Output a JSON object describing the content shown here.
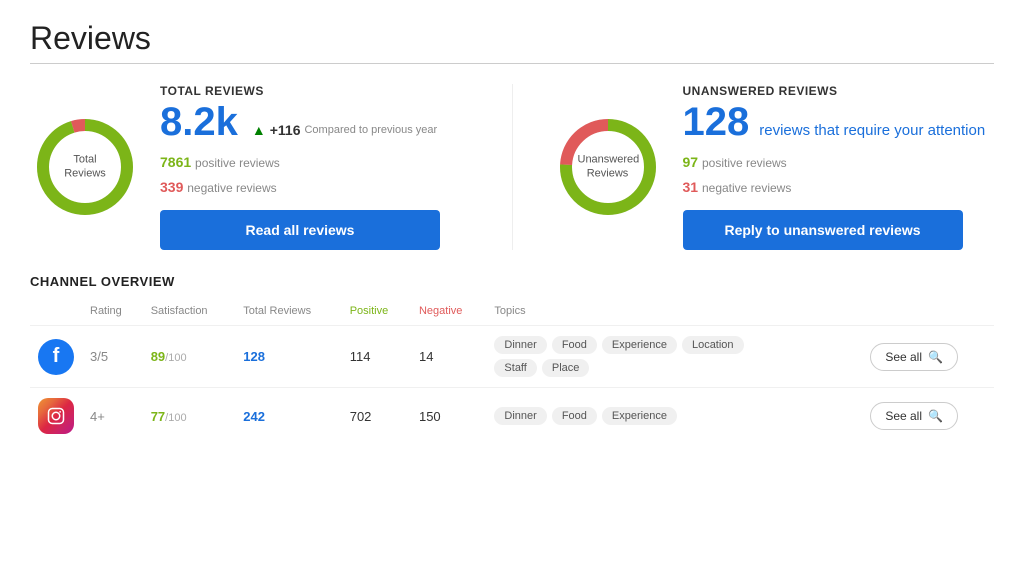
{
  "page": {
    "title": "Reviews"
  },
  "total_reviews": {
    "label": "TOTAL REVIEWS",
    "big_number": "8.2k",
    "arrow": "▲",
    "delta": "+116",
    "compared_label": "Compared to previous year",
    "positive_count": "7861",
    "positive_label": "positive reviews",
    "negative_count": "339",
    "negative_label": "negative reviews",
    "donut_center_line1": "Total",
    "donut_center_line2": "Reviews",
    "read_button": "Read all reviews"
  },
  "unanswered_reviews": {
    "label": "UNANSWERED REVIEWS",
    "big_number": "128",
    "subtitle": "reviews that require your attention",
    "positive_count": "97",
    "positive_label": "positive reviews",
    "negative_count": "31",
    "negative_label": "negative reviews",
    "donut_center_line1": "Unanswered",
    "donut_center_line2": "Reviews",
    "reply_button": "Reply to unanswered reviews"
  },
  "channel_overview": {
    "title": "CHANNEL OVERVIEW",
    "columns": {
      "rating": "Rating",
      "satisfaction": "Satisfaction",
      "total_reviews": "Total Reviews",
      "positive": "Positive",
      "negative": "Negative",
      "topics": "Topics"
    },
    "channels": [
      {
        "name": "Facebook",
        "icon": "facebook",
        "rating": "3/5",
        "satisfaction": "89",
        "satisfaction_denom": "/100",
        "total_reviews": "128",
        "positive": "114",
        "negative": "14",
        "tags": [
          "Dinner",
          "Food",
          "Experience",
          "Location",
          "Staff",
          "Place"
        ],
        "see_all": "See all"
      },
      {
        "name": "Instagram",
        "icon": "instagram",
        "rating": "4+",
        "satisfaction": "77",
        "satisfaction_denom": "/100",
        "total_reviews": "242",
        "positive": "702",
        "negative": "150",
        "tags": [
          "Dinner",
          "Food",
          "Experience"
        ],
        "see_all": "See all"
      }
    ]
  }
}
